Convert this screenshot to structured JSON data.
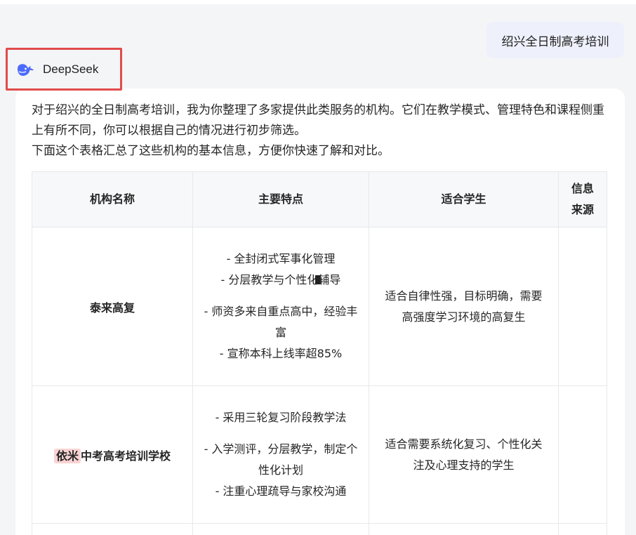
{
  "user_message": {
    "text": "绍兴全日制高考培训"
  },
  "assistant": {
    "name": "DeepSeek",
    "logo_icon": "deepseek-whale-icon",
    "accent_color": "#4d6bfe",
    "highlight_box_color": "#e14b4b"
  },
  "intro": {
    "paragraph_1": "对于绍兴的全日制高考培训，我为你整理了多家提供此类服务的机构。它们在教学模式、管理特色和课程侧重上有所不同，你可以根据自己的情况进行初步筛选。",
    "paragraph_2": "下面这个表格汇总了这些机构的基本信息，方便你快速了解和对比。"
  },
  "table": {
    "headers": {
      "name": "机构名称",
      "features": "主要特点",
      "suits": "适合学生",
      "source": "信息来源"
    },
    "rows": [
      {
        "name": "泰来高复",
        "features": [
          "- 全封闭式军事化管理",
          "- 分层教学与个性化",
          "辅导",
          "- 师资多来自重点高中，经验丰富",
          "- 宣称本科上线率超85%"
        ],
        "suits": "适合自律性强，目标明确，需要高强度学习环境的高复生",
        "source": ""
      },
      {
        "name_highlight": "依米",
        "name_rest": "中考高考培训学校",
        "features": [
          "- 采用三轮复习阶段教学法",
          "- 入学测评，分层教学，制定个性化计划",
          "- 注重心理疏导与家校沟通"
        ],
        "suits": "适合需要系统化复习、个性化关注及心理支持的学生",
        "source": ""
      }
    ]
  }
}
